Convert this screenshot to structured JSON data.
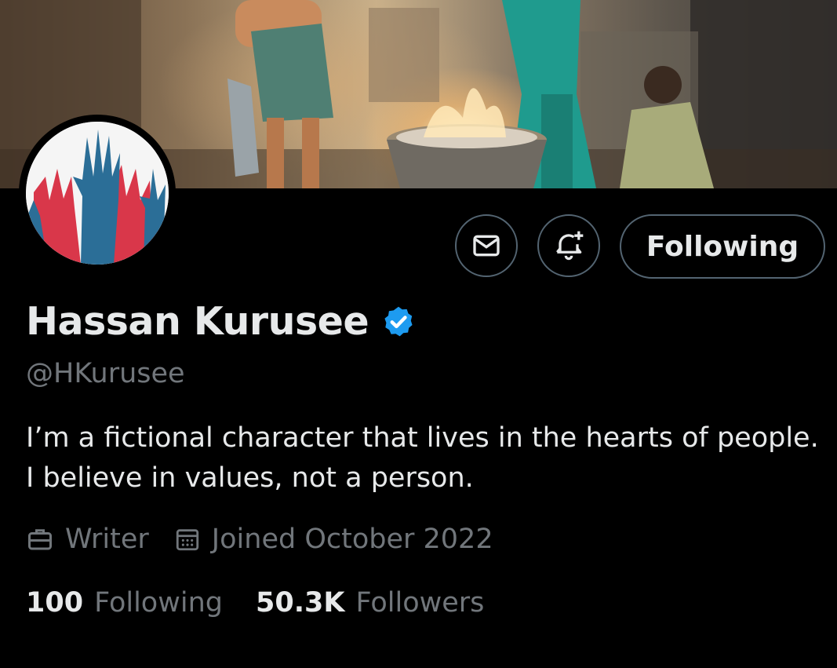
{
  "profile": {
    "name": "Hassan Kurusee",
    "handle": "@HKurusee",
    "bio_lines": [
      "I’m a fictional character that lives in the hearts of people.",
      "I believe in values, not a person."
    ],
    "profession": "Writer",
    "joined": "Joined October 2022",
    "following_count": "100",
    "following_label": "Following",
    "followers_count": "50.3K",
    "followers_label": "Followers",
    "verified": true
  },
  "actions": {
    "message_icon": "envelope-icon",
    "notify_icon": "bell-plus-icon",
    "follow_label": "Following"
  },
  "colors": {
    "background": "#000000",
    "text_primary": "#e7e9ea",
    "text_secondary": "#71767b",
    "border": "#536471",
    "verified_blue": "#1d9bf0"
  }
}
